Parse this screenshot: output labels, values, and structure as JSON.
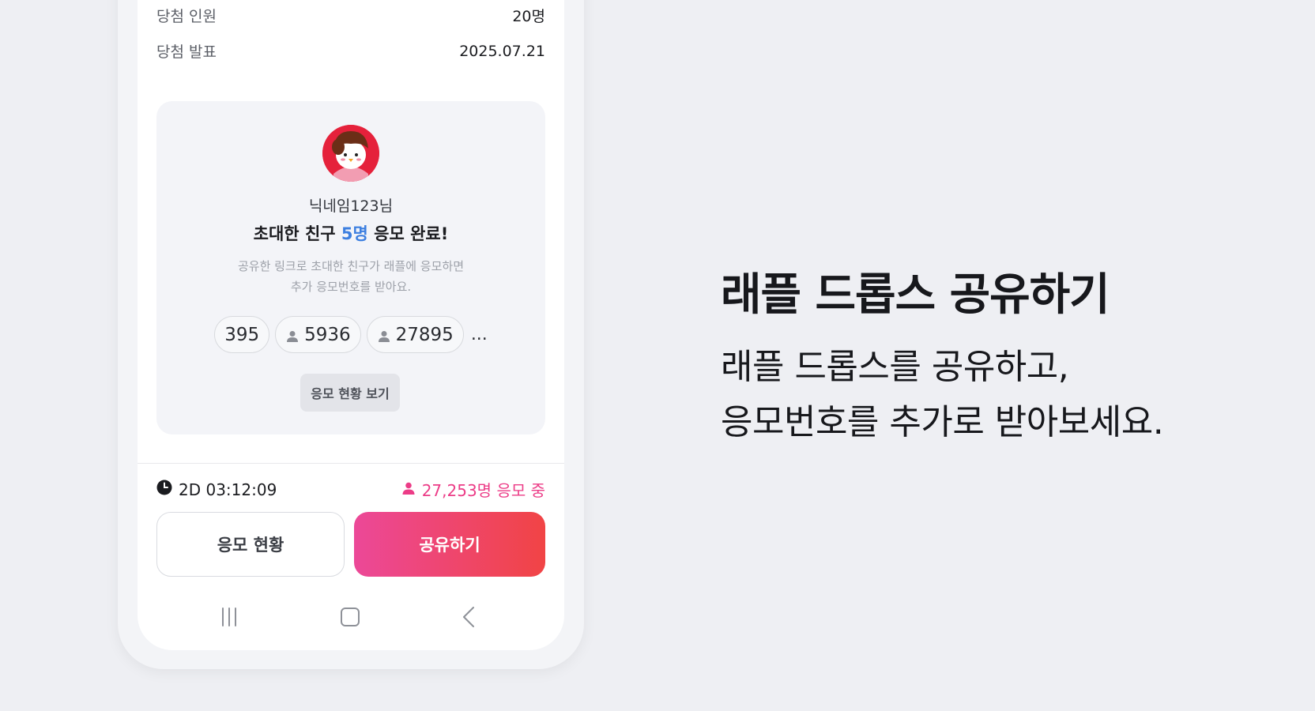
{
  "info": {
    "winners_label": "당첨 인원",
    "winners_value": "20명",
    "announce_label": "당첨 발표",
    "announce_value": "2025.07.21"
  },
  "invite_card": {
    "nickname": "닉네임123님",
    "title_prefix": "초대한 친구 ",
    "title_highlight": "5명",
    "title_suffix": " 응모 완료!",
    "desc_line1": "공유한 링크로 초대한 친구가 래플에 응모하면",
    "desc_line2": "추가 응모번호를 받아요.",
    "entry_numbers": [
      "395",
      "5936",
      "27895"
    ],
    "more": "...",
    "view_button": "응모 현황 보기"
  },
  "status": {
    "timer": "2D 03:12:09",
    "participants": "27,253명 응모 중"
  },
  "buttons": {
    "status_label": "응모 현황",
    "share_label": "공유하기"
  },
  "promo": {
    "headline": "래플 드롭스 공유하기",
    "sub_line1": "래플 드롭스를 공유하고,",
    "sub_line2": "응모번호를 추가로 받아보세요."
  },
  "colors": {
    "accent_pink": "#ec3c87",
    "highlight_blue": "#3d7fe0",
    "primary_gradient_start": "#ec4898",
    "primary_gradient_end": "#f14445",
    "background": "#eeeff3"
  },
  "icons": [
    "clock-icon",
    "person-icon",
    "recent-apps-icon",
    "home-icon",
    "back-icon"
  ]
}
